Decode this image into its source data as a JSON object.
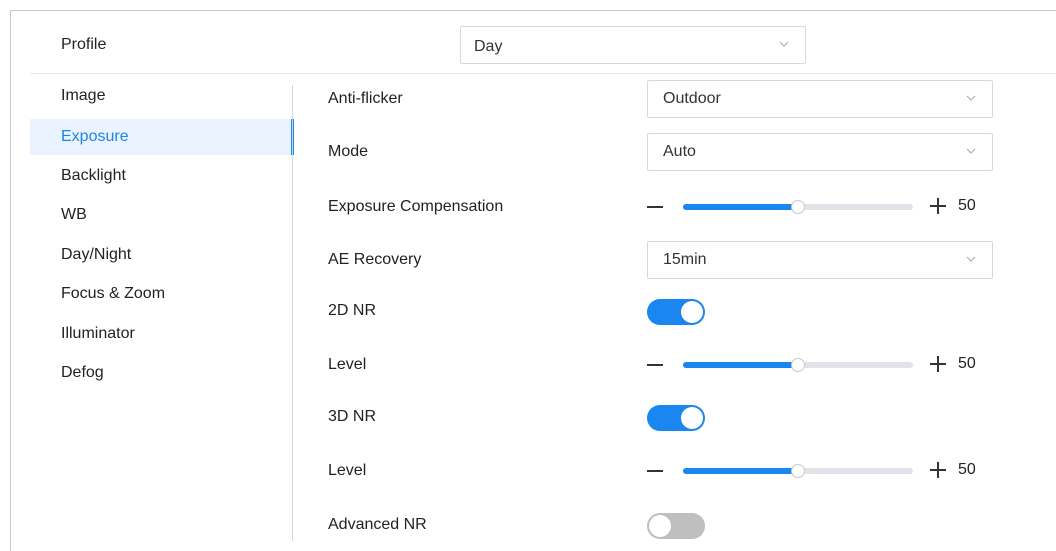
{
  "profile": {
    "label": "Profile",
    "value": "Day"
  },
  "sidebar": {
    "items": [
      {
        "label": "Image",
        "active": false
      },
      {
        "label": "Exposure",
        "active": true
      },
      {
        "label": "Backlight",
        "active": false
      },
      {
        "label": "WB",
        "active": false
      },
      {
        "label": "Day/Night",
        "active": false
      },
      {
        "label": "Focus & Zoom",
        "active": false
      },
      {
        "label": "Illuminator",
        "active": false
      },
      {
        "label": "Defog",
        "active": false
      }
    ]
  },
  "settings": {
    "anti_flicker": {
      "label": "Anti-flicker",
      "value": "Outdoor"
    },
    "mode": {
      "label": "Mode",
      "value": "Auto"
    },
    "exposure_compensation": {
      "label": "Exposure Compensation",
      "value": "50",
      "percent": 50
    },
    "ae_recovery": {
      "label": "AE Recovery",
      "value": "15min"
    },
    "nr_2d": {
      "label": "2D NR",
      "enabled": true
    },
    "nr_2d_level": {
      "label": "Level",
      "value": "50",
      "percent": 50
    },
    "nr_3d": {
      "label": "3D NR",
      "enabled": true
    },
    "nr_3d_level": {
      "label": "Level",
      "value": "50",
      "percent": 50
    },
    "advanced_nr": {
      "label": "Advanced NR",
      "enabled": false
    }
  },
  "colors": {
    "accent": "#1a86f0",
    "toggle_off": "#bfbfbf",
    "track": "#e1e3e8"
  },
  "icons": {
    "dropdown": "chevron-down-icon",
    "decrease": "minus-icon",
    "increase": "plus-icon"
  }
}
